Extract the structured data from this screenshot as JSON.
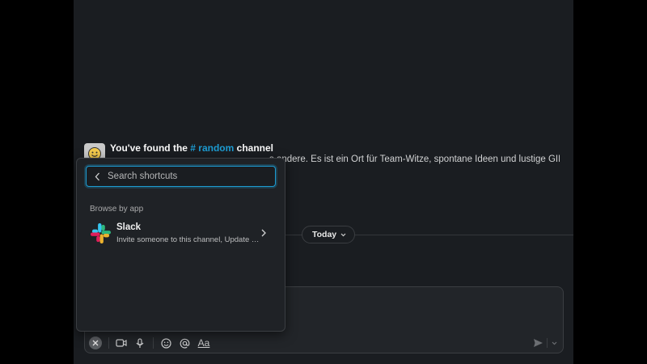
{
  "intro": {
    "title_prefix": "You've found the ",
    "channel": "# random",
    "title_suffix": " channel",
    "description": "s andere. Es ist ein Ort für Team-Witze, spontane Ideen und lustige GIFs."
  },
  "date_divider": {
    "label": "Today"
  },
  "shortcuts_popover": {
    "search": {
      "placeholder": "Search shortcuts",
      "value": ""
    },
    "section_label": "Browse by app",
    "apps": [
      {
        "name": "Slack",
        "subtitle": "Invite someone to this channel, Update y..."
      }
    ]
  },
  "composer": {
    "format_label": "Aa",
    "icons": [
      "close-icon",
      "video-icon",
      "microphone-icon",
      "emoji-icon",
      "mention-icon",
      "format-icon",
      "send-icon",
      "chevron-down-icon"
    ]
  },
  "colors": {
    "app_background": "#1a1d21",
    "accent": "#1d9bd1",
    "popover": "#1f2226"
  }
}
